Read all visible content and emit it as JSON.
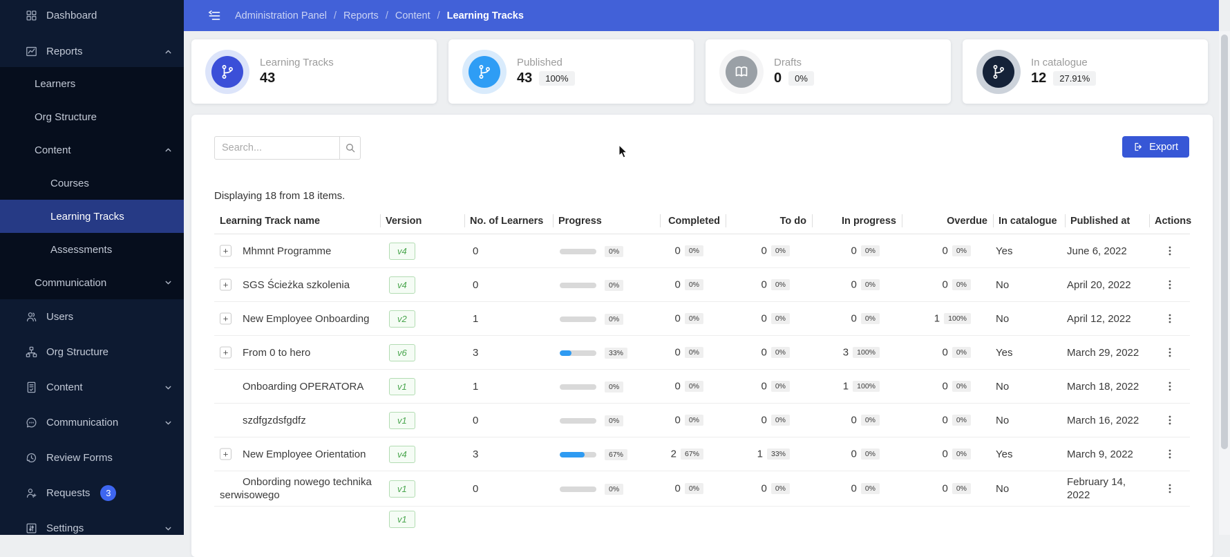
{
  "colors": {
    "header_blue": "#4261d8",
    "export_blue": "#3757d6",
    "sidebar_bg": "#0d1a31",
    "submenu_bg": "#060e1d",
    "selected_blue": "#263a85",
    "progress_fill": "#2f9bf2",
    "version_green": "#4aa64e"
  },
  "sidebar": {
    "items": [
      {
        "id": "dashboard",
        "label": "Dashboard",
        "icon": "grid-icon",
        "level": 0,
        "group": "top"
      },
      {
        "id": "reports",
        "label": "Reports",
        "icon": "chart-icon",
        "level": 0,
        "group": "top",
        "chevron": "up"
      },
      {
        "id": "reports-learners",
        "label": "Learners",
        "level": 1,
        "group": "sub"
      },
      {
        "id": "reports-org-structure",
        "label": "Org Structure",
        "level": 1,
        "group": "sub"
      },
      {
        "id": "reports-content",
        "label": "Content",
        "level": 1,
        "group": "sub",
        "chevron": "up"
      },
      {
        "id": "reports-courses",
        "label": "Courses",
        "level": 2,
        "group": "sub"
      },
      {
        "id": "reports-learning-tracks",
        "label": "Learning Tracks",
        "level": 2,
        "group": "sub",
        "selected": true
      },
      {
        "id": "reports-assessments",
        "label": "Assessments",
        "level": 2,
        "group": "sub"
      },
      {
        "id": "reports-communication",
        "label": "Communication",
        "level": 1,
        "group": "sub",
        "chevron": "down"
      },
      {
        "id": "users",
        "label": "Users",
        "icon": "users-icon",
        "level": 0,
        "group": "main"
      },
      {
        "id": "org-structure",
        "label": "Org Structure",
        "icon": "org-chart-icon",
        "level": 0,
        "group": "main"
      },
      {
        "id": "content",
        "label": "Content",
        "icon": "document-icon",
        "level": 0,
        "group": "main",
        "chevron": "down"
      },
      {
        "id": "communication",
        "label": "Communication",
        "icon": "chat-icon",
        "level": 0,
        "group": "main",
        "chevron": "down"
      },
      {
        "id": "review-forms",
        "label": "Review Forms",
        "icon": "history-icon",
        "level": 0,
        "group": "main"
      },
      {
        "id": "requests",
        "label": "Requests",
        "icon": "person-plus-icon",
        "level": 0,
        "group": "main",
        "badge": "3"
      },
      {
        "id": "settings",
        "label": "Settings",
        "icon": "sliders-icon",
        "level": 0,
        "group": "main",
        "chevron": "down"
      }
    ]
  },
  "breadcrumb": {
    "items": [
      "Administration Panel",
      "Reports",
      "Content",
      "Learning Tracks"
    ]
  },
  "cards": [
    {
      "id": "learning-tracks",
      "label": "Learning Tracks",
      "value": "43",
      "badge": null,
      "icon": "git-branch-icon",
      "icon_bg": "#3b4fd8",
      "ring": "#dce4fa"
    },
    {
      "id": "published",
      "label": "Published",
      "value": "43",
      "badge": "100%",
      "icon": "git-branch-icon",
      "icon_bg": "#2e9df5",
      "ring": "#d9ebfc"
    },
    {
      "id": "drafts",
      "label": "Drafts",
      "value": "0",
      "badge": "0%",
      "icon": "book-open-icon",
      "icon_bg": "#9aa0a6",
      "ring": "#f4f4f5"
    },
    {
      "id": "in-catalogue",
      "label": "In catalogue",
      "value": "12",
      "badge": "27.91%",
      "icon": "git-branch-icon",
      "icon_bg": "#152238",
      "ring": "#ccd2da"
    }
  ],
  "toolbar": {
    "search_placeholder": "Search...",
    "export_label": "Export"
  },
  "table": {
    "summary": "Displaying 18 from 18 items.",
    "columns": [
      "Learning Track name",
      "Version",
      "No. of Learners",
      "Progress",
      "Completed",
      "To do",
      "In progress",
      "Overdue",
      "In catalogue",
      "Published at",
      "Actions"
    ],
    "rows": [
      {
        "expand": true,
        "name": "Mhmnt Programme",
        "version": "v4",
        "learners": "0",
        "progress": {
          "pct": 0,
          "label": "0%"
        },
        "completed": {
          "value": "0",
          "pct": "0%"
        },
        "todo": {
          "value": "0",
          "pct": "0%"
        },
        "inprogress": {
          "value": "0",
          "pct": "0%"
        },
        "overdue": {
          "value": "0",
          "pct": "0%"
        },
        "catalogue": "Yes",
        "published": "June 6, 2022"
      },
      {
        "expand": true,
        "name": "SGS Ścieżka szkolenia",
        "version": "v4",
        "learners": "0",
        "progress": {
          "pct": 0,
          "label": "0%"
        },
        "completed": {
          "value": "0",
          "pct": "0%"
        },
        "todo": {
          "value": "0",
          "pct": "0%"
        },
        "inprogress": {
          "value": "0",
          "pct": "0%"
        },
        "overdue": {
          "value": "0",
          "pct": "0%"
        },
        "catalogue": "No",
        "published": "April 20, 2022"
      },
      {
        "expand": true,
        "name": "New Employee Onboarding",
        "version": "v2",
        "learners": "1",
        "progress": {
          "pct": 0,
          "label": "0%"
        },
        "completed": {
          "value": "0",
          "pct": "0%"
        },
        "todo": {
          "value": "0",
          "pct": "0%"
        },
        "inprogress": {
          "value": "0",
          "pct": "0%"
        },
        "overdue": {
          "value": "1",
          "pct": "100%"
        },
        "catalogue": "No",
        "published": "April 12, 2022"
      },
      {
        "expand": true,
        "name": "From 0 to hero",
        "version": "v6",
        "learners": "3",
        "progress": {
          "pct": 33,
          "label": "33%"
        },
        "completed": {
          "value": "0",
          "pct": "0%"
        },
        "todo": {
          "value": "0",
          "pct": "0%"
        },
        "inprogress": {
          "value": "3",
          "pct": "100%"
        },
        "overdue": {
          "value": "0",
          "pct": "0%"
        },
        "catalogue": "Yes",
        "published": "March 29, 2022"
      },
      {
        "expand": false,
        "name": "Onboarding OPERATORA",
        "version": "v1",
        "learners": "1",
        "progress": {
          "pct": 0,
          "label": "0%"
        },
        "completed": {
          "value": "0",
          "pct": "0%"
        },
        "todo": {
          "value": "0",
          "pct": "0%"
        },
        "inprogress": {
          "value": "1",
          "pct": "100%"
        },
        "overdue": {
          "value": "0",
          "pct": "0%"
        },
        "catalogue": "No",
        "published": "March 18, 2022"
      },
      {
        "expand": false,
        "name": "szdfgzdsfgdfz",
        "version": "v1",
        "learners": "0",
        "progress": {
          "pct": 0,
          "label": "0%"
        },
        "completed": {
          "value": "0",
          "pct": "0%"
        },
        "todo": {
          "value": "0",
          "pct": "0%"
        },
        "inprogress": {
          "value": "0",
          "pct": "0%"
        },
        "overdue": {
          "value": "0",
          "pct": "0%"
        },
        "catalogue": "No",
        "published": "March 16, 2022"
      },
      {
        "expand": true,
        "name": "New Employee Orientation",
        "version": "v4",
        "learners": "3",
        "progress": {
          "pct": 67,
          "label": "67%"
        },
        "completed": {
          "value": "2",
          "pct": "67%"
        },
        "todo": {
          "value": "1",
          "pct": "33%"
        },
        "inprogress": {
          "value": "0",
          "pct": "0%"
        },
        "overdue": {
          "value": "0",
          "pct": "0%"
        },
        "catalogue": "Yes",
        "published": "March 9, 2022"
      },
      {
        "expand": false,
        "name": "Onbording nowego technika serwisowego",
        "version": "v1",
        "learners": "0",
        "progress": {
          "pct": 0,
          "label": "0%"
        },
        "completed": {
          "value": "0",
          "pct": "0%"
        },
        "todo": {
          "value": "0",
          "pct": "0%"
        },
        "inprogress": {
          "value": "0",
          "pct": "0%"
        },
        "overdue": {
          "value": "0",
          "pct": "0%"
        },
        "catalogue": "No",
        "published": "February 14, 2022"
      },
      {
        "partial": true,
        "version": "v1"
      }
    ]
  }
}
